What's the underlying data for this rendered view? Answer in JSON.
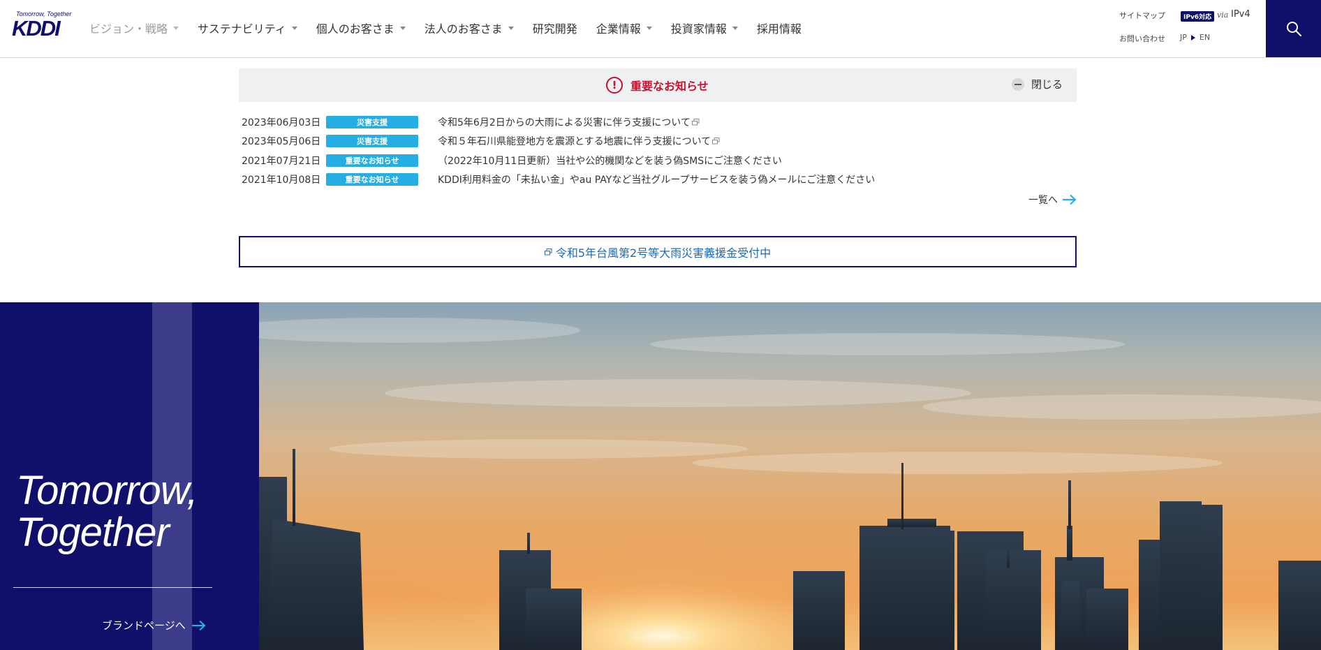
{
  "header": {
    "logo_tagline": "Tomorrow, Together",
    "logo_text": "KDDI",
    "nav": [
      {
        "label": "ビジョン・戦略",
        "dropdown": true,
        "dim": true
      },
      {
        "label": "サステナビリティ",
        "dropdown": true
      },
      {
        "label": "個人のお客さま",
        "dropdown": true
      },
      {
        "label": "法人のお客さま",
        "dropdown": true
      },
      {
        "label": "研究開発",
        "dropdown": false
      },
      {
        "label": "企業情報",
        "dropdown": true
      },
      {
        "label": "投資家情報",
        "dropdown": true
      },
      {
        "label": "採用情報",
        "dropdown": false
      }
    ],
    "utility": {
      "sitemap": "サイトマップ",
      "contact": "お問い合わせ",
      "ipv6_badge": "IPv6対応",
      "via": "via",
      "ipv4": "IPv4",
      "lang_jp": "JP",
      "lang_en": "EN"
    },
    "search_icon": "search-icon"
  },
  "notice": {
    "title": "重要なお知らせ",
    "close_label": "閉じる",
    "items": [
      {
        "date": "2023年06月03日",
        "badge": "災害支援",
        "title": "令和5年6月2日からの大雨による災害に伴う支援について",
        "external": true
      },
      {
        "date": "2023年05月06日",
        "badge": "災害支援",
        "title": "令和５年石川県能登地方を震源とする地震に伴う支援について",
        "external": true
      },
      {
        "date": "2021年07月21日",
        "badge": "重要なお知らせ",
        "title": "（2022年10月11日更新）当社や公的機関などを装う偽SMSにご注意ください",
        "external": false
      },
      {
        "date": "2021年10月08日",
        "badge": "重要なお知らせ",
        "title": "KDDI利用料金の「未払い金」やau PAYなど当社グループサービスを装う偽メールにご注意ください",
        "external": false
      }
    ],
    "more_label": "一覧へ"
  },
  "donation": {
    "label": "令和5年台風第2号等大雨災害義援金受付中"
  },
  "hero": {
    "slogan_line1": "Tomorrow,",
    "slogan_line2": "Together",
    "brand_link": "ブランドページへ"
  },
  "colors": {
    "brand_navy": "#10106b",
    "badge_blue": "#24aee3",
    "alert_red": "#c8102e",
    "link_blue": "#1e6ab5"
  }
}
